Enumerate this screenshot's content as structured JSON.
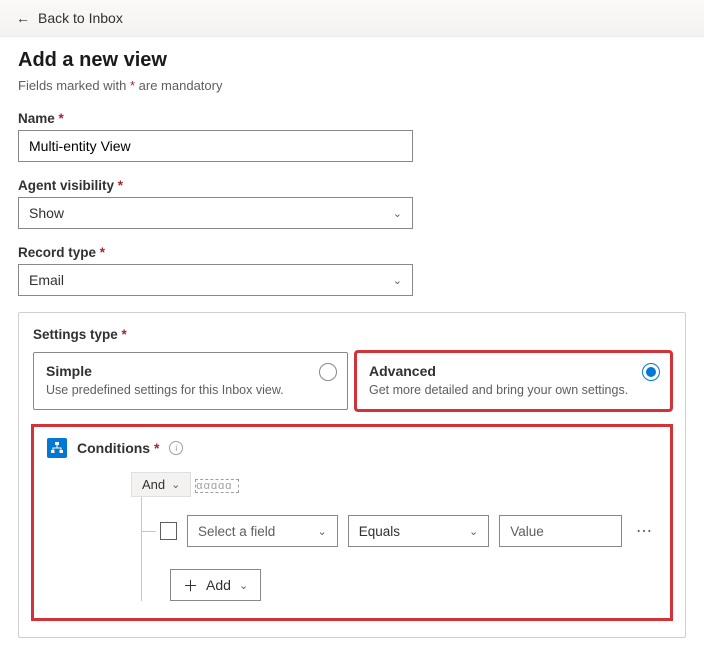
{
  "back_link": "Back to Inbox",
  "page_title": "Add a new view",
  "mandatory_prefix": "Fields marked with ",
  "mandatory_asterisk": "*",
  "mandatory_suffix": " are mandatory",
  "fields": {
    "name": {
      "label": "Name",
      "value": "Multi-entity View"
    },
    "agent_visibility": {
      "label": "Agent visibility",
      "value": "Show"
    },
    "record_type": {
      "label": "Record type",
      "value": "Email"
    }
  },
  "settings_type": {
    "label": "Settings type",
    "simple": {
      "title": "Simple",
      "desc": "Use predefined settings for this Inbox view."
    },
    "advanced": {
      "title": "Advanced",
      "desc": "Get more detailed and bring your own settings."
    },
    "selected": "advanced"
  },
  "conditions": {
    "title": "Conditions",
    "logic_op": "And",
    "partial_text": "ααɑɑɑ",
    "row": {
      "field_placeholder": "Select a field",
      "operator": "Equals",
      "value_placeholder": "Value"
    },
    "add_label": "Add"
  }
}
